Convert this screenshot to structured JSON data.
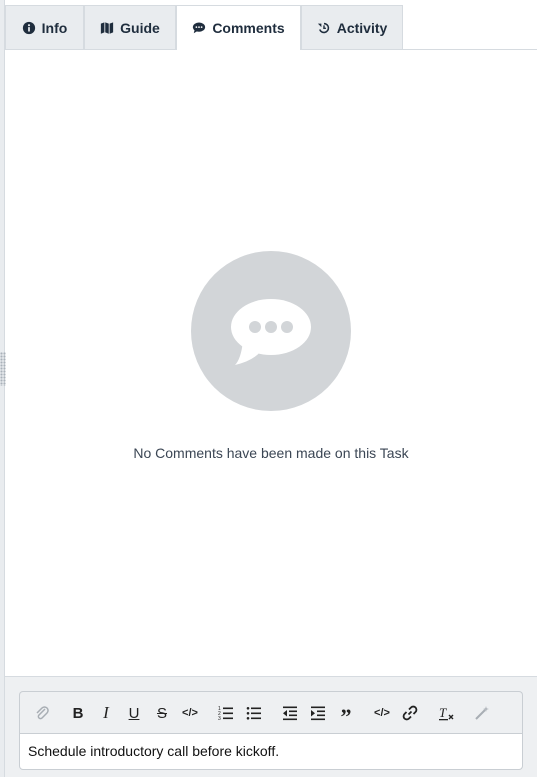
{
  "tabs": [
    {
      "label": "Info",
      "icon": "info-icon"
    },
    {
      "label": "Guide",
      "icon": "map-icon"
    },
    {
      "label": "Comments",
      "icon": "comment-icon",
      "active": true
    },
    {
      "label": "Activity",
      "icon": "history-icon"
    }
  ],
  "empty_state": {
    "message": "No Comments have been made on this Task",
    "icon": "comment-bubble-icon"
  },
  "editor": {
    "toolbar": [
      {
        "name": "attach",
        "icon": "paperclip-icon",
        "enabled": false
      },
      {
        "name": "bold",
        "icon": "bold-icon",
        "enabled": true
      },
      {
        "name": "italic",
        "icon": "italic-icon",
        "enabled": true
      },
      {
        "name": "underline",
        "icon": "underline-icon",
        "enabled": true
      },
      {
        "name": "strikethrough",
        "icon": "strikethrough-icon",
        "enabled": true
      },
      {
        "name": "inline-code",
        "icon": "code-icon",
        "enabled": true
      },
      {
        "name": "ordered-list",
        "icon": "ordered-list-icon",
        "enabled": true
      },
      {
        "name": "bullet-list",
        "icon": "bullet-list-icon",
        "enabled": true
      },
      {
        "name": "outdent",
        "icon": "outdent-icon",
        "enabled": true
      },
      {
        "name": "indent",
        "icon": "indent-icon",
        "enabled": true
      },
      {
        "name": "blockquote",
        "icon": "quote-icon",
        "enabled": true
      },
      {
        "name": "code-block",
        "icon": "code-block-icon",
        "enabled": true
      },
      {
        "name": "link",
        "icon": "link-icon",
        "enabled": true
      },
      {
        "name": "clear-format",
        "icon": "clear-format-icon",
        "enabled": true
      },
      {
        "name": "magic",
        "icon": "magic-wand-icon",
        "enabled": false
      }
    ],
    "value": "Schedule introductory call before kickoff."
  },
  "colors": {
    "tab_bg": "#e9ecef",
    "active_tab_bg": "#ffffff",
    "empty_circle": "#d2d5d8",
    "text": "#1f2d3d"
  }
}
